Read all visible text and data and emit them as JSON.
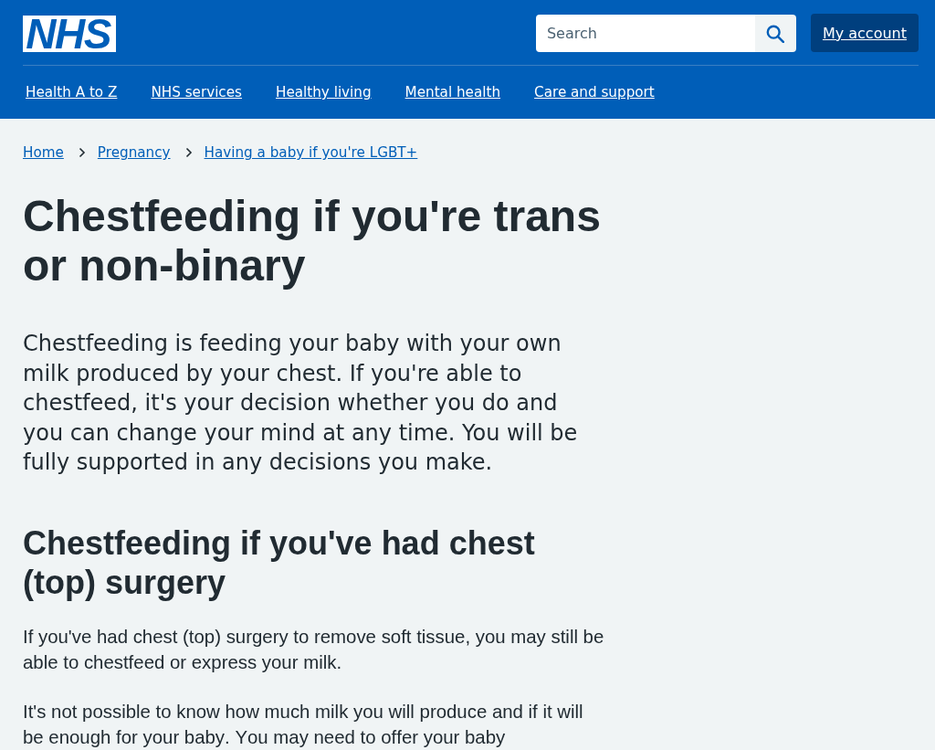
{
  "header": {
    "logo": "NHS",
    "search": {
      "placeholder": "Search"
    },
    "account_button": "My account",
    "nav": [
      "Health A to Z",
      "NHS services",
      "Healthy living",
      "Mental health",
      "Care and support"
    ]
  },
  "breadcrumbs": [
    "Home",
    "Pregnancy",
    "Having a baby if you're LGBT+"
  ],
  "title": "Chestfeeding if you're trans or non-binary",
  "lead": "Chestfeeding is feeding your baby with your own milk produced by your chest. If you're able to chestfeed, it's your decision whether you do and you can change your mind at any time. You will be fully supported in any decisions you make.",
  "sections": [
    {
      "heading": "Chestfeeding if you've had chest (top) surgery",
      "paragraphs": [
        "If you've had chest (top) surgery to remove soft tissue, you may still be able to chestfeed or express your milk.",
        "It's not possible to know how much milk you will produce and if it will be enough for your baby. You may need to offer your baby"
      ]
    }
  ]
}
